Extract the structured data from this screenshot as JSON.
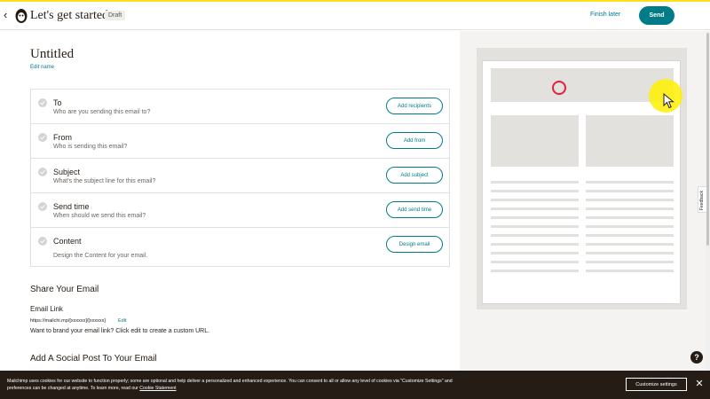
{
  "header": {
    "title": "Let's get started!",
    "badge": "Draft",
    "finish_later": "Finish later",
    "send": "Send"
  },
  "campaign": {
    "name": "Untitled",
    "edit_name": "Edit name"
  },
  "checklist": [
    {
      "title": "To",
      "subtitle": "Who are you sending this email to?",
      "button": "Add recipients"
    },
    {
      "title": "From",
      "subtitle": "Who is sending this email?",
      "button": "Add from"
    },
    {
      "title": "Subject",
      "subtitle": "What's the subject line for this email?",
      "button": "Add subject"
    },
    {
      "title": "Send time",
      "subtitle": "When should we send this email?",
      "button": "Add send time"
    },
    {
      "title": "Content",
      "subtitle": "Design the Content for your email.",
      "button": "Design email"
    }
  ],
  "share": {
    "heading": "Share Your Email",
    "link_label": "Email Link",
    "link_url": "https://mailchi.mp/[xxxxxx]/[xxxxxx]",
    "edit": "Edit",
    "brand_text": "Want to brand your email link? Click edit to create a custom URL."
  },
  "social": {
    "heading": "Add A Social Post To Your Email"
  },
  "feedback": "Feedback",
  "help": "?",
  "cookie": {
    "text": "Mailchimp uses cookies for our website to function properly; some are optional and help deliver a personalized and enhanced experience. You can consent to all or allow any level of cookies via \"Customize Settings\" and preferences can be changed at anytime. To learn more, read our",
    "link": "Cookie Statement",
    "customize": "Customize settings",
    "close": "✕"
  },
  "colors": {
    "accent": "#007c89",
    "brand_yellow": "#ffe01b",
    "dark": "#241c15",
    "annotation_red": "#e0203a"
  }
}
